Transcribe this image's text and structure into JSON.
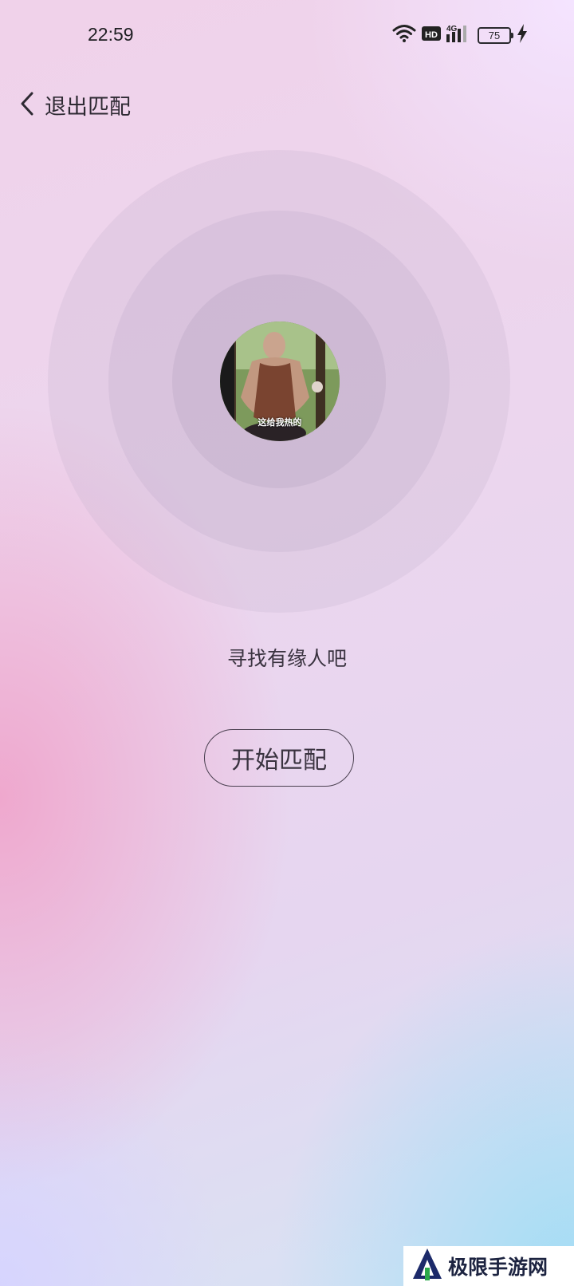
{
  "status_bar": {
    "time": "22:59",
    "hd_label": "HD",
    "network_label": "4G",
    "battery_level": "75",
    "icons": [
      "wifi-icon",
      "hd-icon",
      "signal-4g-icon",
      "battery-icon",
      "charging-icon"
    ]
  },
  "header": {
    "back_label": "退出匹配"
  },
  "main": {
    "avatar_caption": "这给我热的",
    "hint": "寻找有缘人吧",
    "start_button": "开始匹配"
  },
  "watermark": {
    "text": "极限手游网"
  },
  "colors": {
    "text": "#3a3340",
    "pink": "#f0a0c8",
    "blue": "#a0dcf5"
  }
}
